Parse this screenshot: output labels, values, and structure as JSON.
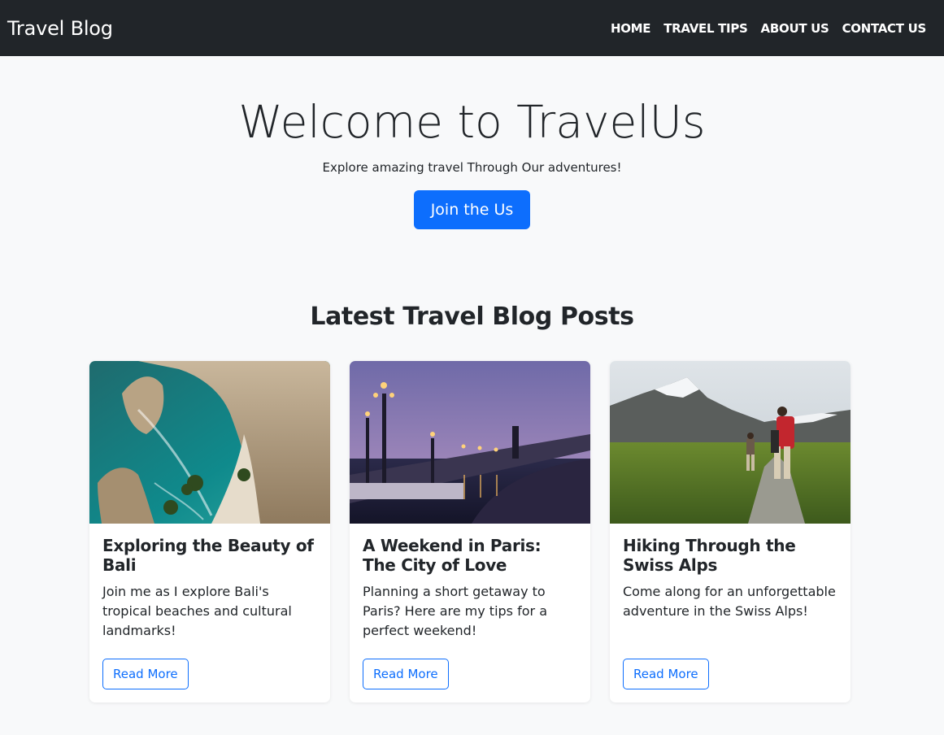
{
  "navbar": {
    "brand": "Travel Blog",
    "links": [
      "HOME",
      "TRAVEL TIPS",
      "ABOUT US",
      "CONTACT US"
    ]
  },
  "hero": {
    "title": "Welcome to TravelUs",
    "subtitle": "Explore amazing travel Through Our adventures!",
    "button_label": "Join the Us"
  },
  "posts_section": {
    "title": "Latest Travel Blog Posts",
    "posts": [
      {
        "title": "Exploring the Beauty of Bali",
        "text": "Join me as I explore Bali's tropical beaches and cultural landmarks!",
        "button_label": "Read More"
      },
      {
        "title": "A Weekend in Paris: The City of Love",
        "text": "Planning a short getaway to Paris? Here are my tips for a perfect weekend!",
        "button_label": "Read More"
      },
      {
        "title": "Hiking Through the Swiss Alps",
        "text": "Come along for an unforgettable adventure in the Swiss Alps!",
        "button_label": "Read More"
      }
    ]
  },
  "colors": {
    "navbar_bg": "#212529",
    "page_bg": "#f8f9fa",
    "primary": "#0d6efd"
  }
}
